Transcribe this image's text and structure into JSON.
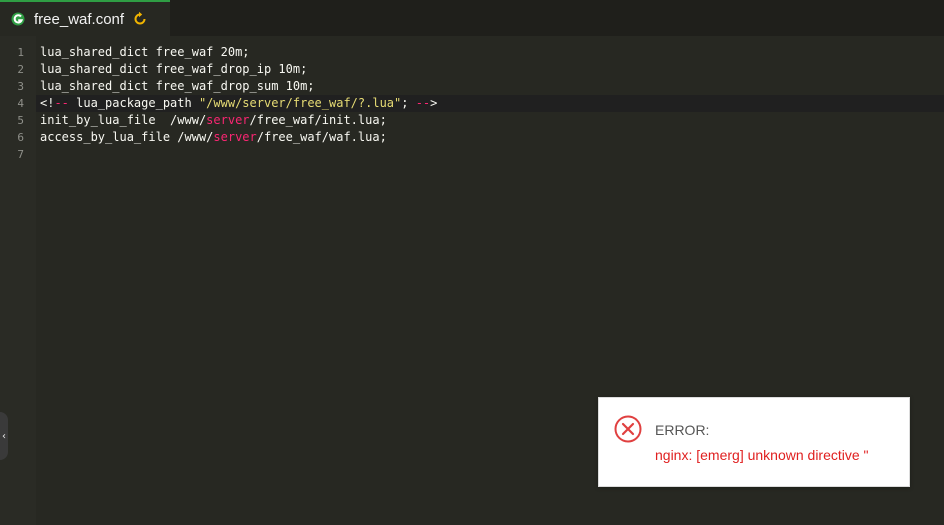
{
  "tab": {
    "title": "free_waf.conf",
    "icon": "g-logo-icon",
    "reload_icon": "refresh-icon",
    "accent": "#2f9e44"
  },
  "editor": {
    "active_line": 4,
    "lines": [
      {
        "num": "1",
        "parts": [
          {
            "text": "lua_shared_dict free_waf 20m;",
            "color": "plain"
          }
        ]
      },
      {
        "num": "2",
        "parts": [
          {
            "text": "lua_shared_dict free_waf_drop_ip 10m;",
            "color": "plain"
          }
        ]
      },
      {
        "num": "3",
        "parts": [
          {
            "text": "lua_shared_dict free_waf_drop_sum 10m;",
            "color": "plain"
          }
        ]
      },
      {
        "num": "4",
        "parts": [
          {
            "text": "<!",
            "color": "plain"
          },
          {
            "text": "--",
            "color": "red"
          },
          {
            "text": " lua_package_path ",
            "color": "plain"
          },
          {
            "text": "\"/www/server/free_waf/?.lua\"",
            "color": "yellow"
          },
          {
            "text": "; ",
            "color": "plain"
          },
          {
            "text": "--",
            "color": "red"
          },
          {
            "text": ">",
            "color": "plain"
          }
        ]
      },
      {
        "num": "5",
        "parts": [
          {
            "text": "init_by_lua_file  /www/",
            "color": "plain"
          },
          {
            "text": "server",
            "color": "red"
          },
          {
            "text": "/free_waf/init.lua;",
            "color": "plain"
          }
        ]
      },
      {
        "num": "6",
        "parts": [
          {
            "text": "access_by_lua_file /www/",
            "color": "plain"
          },
          {
            "text": "server",
            "color": "red"
          },
          {
            "text": "/free_waf/waf.lua;",
            "color": "plain"
          }
        ]
      },
      {
        "num": "7",
        "parts": []
      }
    ]
  },
  "side_handle": {
    "icon": "chevron-left-icon"
  },
  "toast": {
    "title": "ERROR:",
    "message": "nginx: [emerg] unknown directive \"",
    "icon": "error-circle-icon",
    "message_color": "#e02020"
  }
}
